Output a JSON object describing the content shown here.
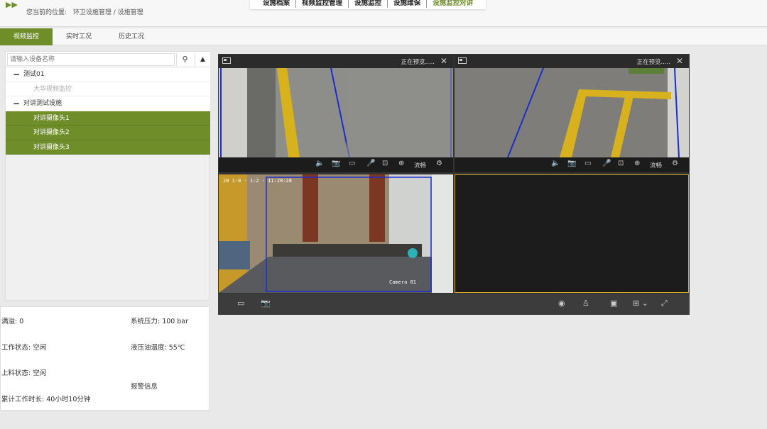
{
  "header": {
    "breadcrumb_prefix": "您当前的位置:",
    "breadcrumb_path": "环卫设施管理 / 设施管理",
    "nav": [
      "设施档案",
      "视频监控管理",
      "设施监控",
      "设施维保",
      "设施监控对讲"
    ]
  },
  "tabs": [
    "视频监控",
    "实时工况",
    "历史工况"
  ],
  "search": {
    "placeholder": "请输入设备名称"
  },
  "tree": {
    "group1": "测试01",
    "group1_child": "大华视频监控",
    "group2": "对讲测试设施",
    "cameras": [
      "对讲摄像头1",
      "对讲摄像头2",
      "对讲摄像头3"
    ]
  },
  "panes": {
    "status": "正在预览.....",
    "quality": "流畅",
    "osd_time": "20 1:0 - 1:2 - 11:20:28",
    "camera_label": "Camera 01"
  },
  "info": {
    "full": "满溢:  0",
    "pressure": "系统压力: 100 bar",
    "work_status": "工作状态: 空闲",
    "oil_temp": "液压油温度: 55℃",
    "load_status": "上料状态: 空闲",
    "alarm": "报警信息",
    "total_time": "累计工作时长:  40小时10分钟"
  },
  "colors": {
    "accent": "#6f8e2a",
    "selected_pane": "#d4a82a"
  }
}
